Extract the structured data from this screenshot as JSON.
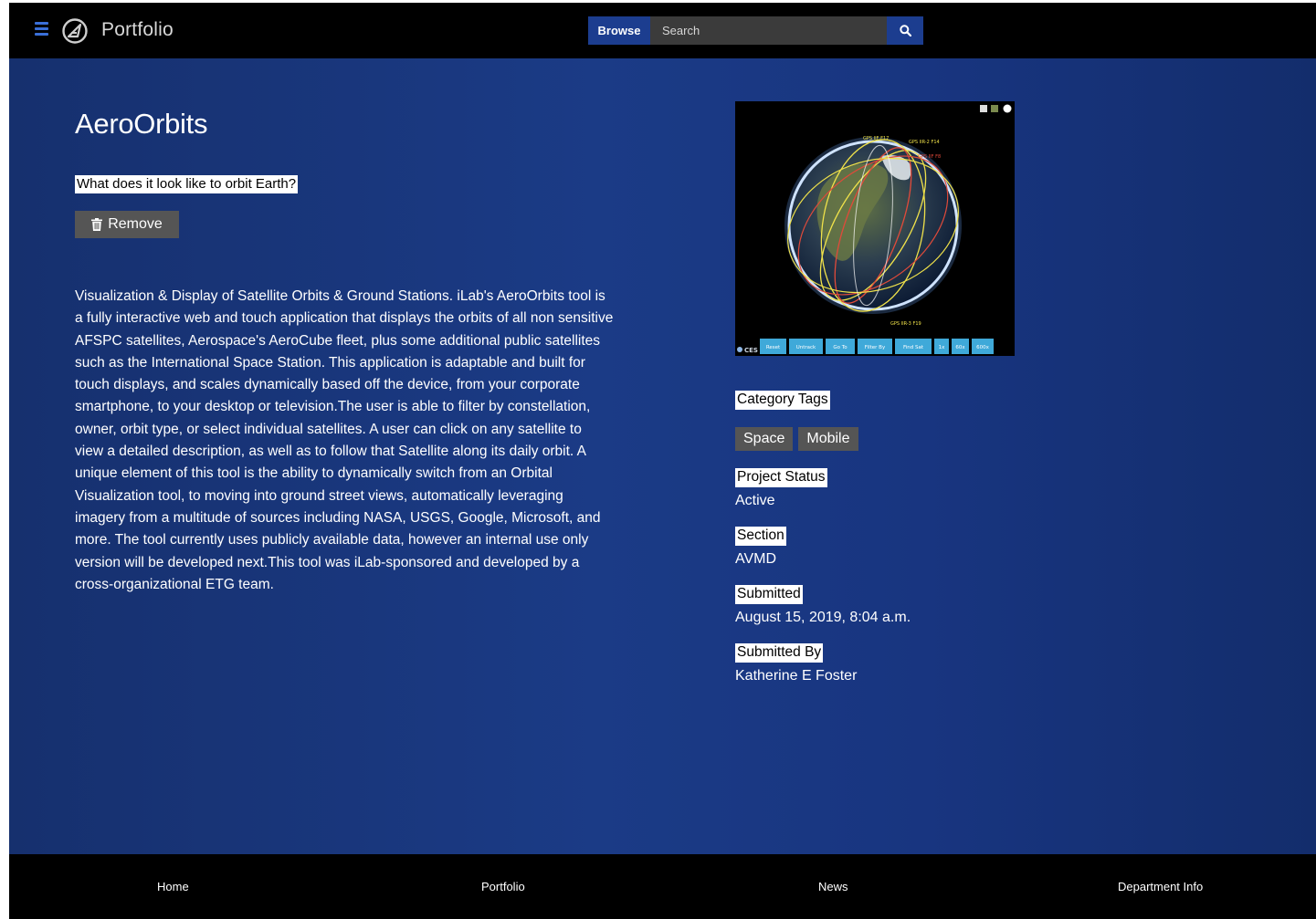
{
  "header": {
    "brand": "Portfolio",
    "browse_label": "Browse",
    "search_placeholder": "Search"
  },
  "project": {
    "title": "AeroOrbits",
    "tagline": "What does it look like to orbit Earth?",
    "remove_label": "Remove",
    "description": "Visualization & Display of Satellite Orbits & Ground Stations. iLab's AeroOrbits tool is a fully interactive web and touch application that displays the orbits of all non sensitive AFSPC satellites, Aerospace's AeroCube fleet, plus some additional public satellites such as the International Space Station. This application is adaptable and built for touch displays, and scales dynamically based off the device, from your corporate smartphone, to your desktop or television.The user is able to filter by constellation, owner, orbit type, or select individual satellites. A user can click on any satellite to view a detailed description, as well as to follow that Satellite along its daily orbit. A unique element of this tool is the ability to dynamically switch from an Orbital Visualization tool, to moving into ground street views, automatically leveraging imagery from a multitude of sources including NASA, USGS, Google, Microsoft, and more. The tool currently uses publicly available data, however an internal use only version will be developed next.This tool was iLab-sponsored and developed by a cross-organizational ETG team."
  },
  "screenshot": {
    "toolbar_buttons": [
      "Reset",
      "Untrack",
      "Go To",
      "Filter By",
      "Find Sat",
      "1x",
      "60x",
      "600x"
    ],
    "logo_text": "CES"
  },
  "meta": {
    "category_tags_label": "Category Tags",
    "tags": [
      "Space",
      "Mobile"
    ],
    "status_label": "Project Status",
    "status_value": "Active",
    "section_label": "Section",
    "section_value": "AVMD",
    "submitted_label": "Submitted",
    "submitted_value": "August 15, 2019, 8:04 a.m.",
    "submitted_by_label": "Submitted By",
    "submitted_by_value": "Katherine E Foster"
  },
  "footer": {
    "links": [
      "Home",
      "Portfolio",
      "News",
      "Department Info"
    ]
  },
  "colors": {
    "accent": "#1c3d8f",
    "hamburger": "#3a6fd8",
    "main_background": "#1b3b86",
    "tag_background": "#555555"
  }
}
